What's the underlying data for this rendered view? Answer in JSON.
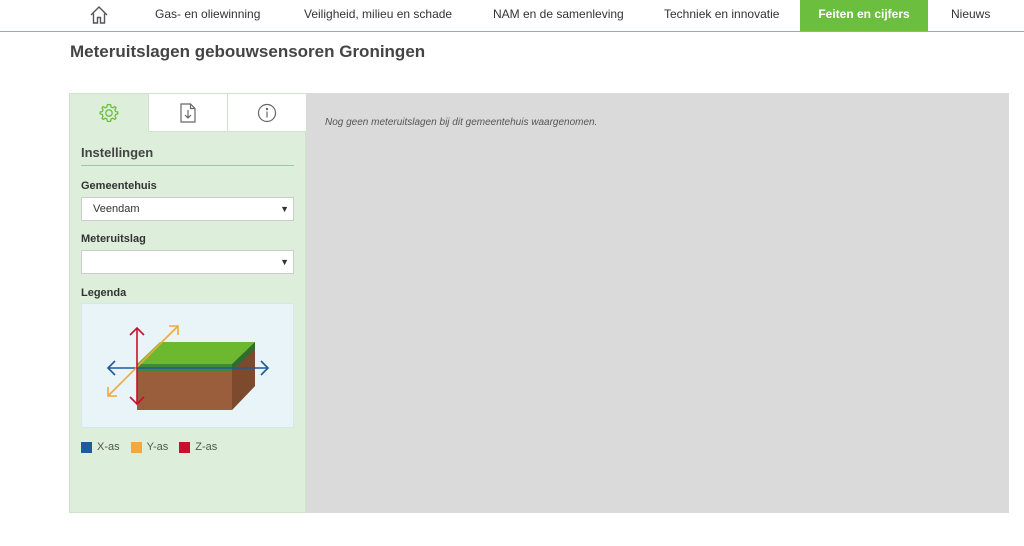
{
  "nav": {
    "items": [
      {
        "label": "Gas- en oliewinning"
      },
      {
        "label": "Veiligheid, milieu en schade"
      },
      {
        "label": "NAM en de samenleving"
      },
      {
        "label": "Techniek en innovatie"
      },
      {
        "label": "Feiten en cijfers",
        "active": true
      },
      {
        "label": "Nieuws"
      }
    ],
    "home_icon": "home-icon"
  },
  "page": {
    "title": "Meteruitslagen gebouwsensoren Groningen"
  },
  "panel": {
    "tabs": [
      {
        "icon": "gear-icon",
        "active": true
      },
      {
        "icon": "download-document-icon"
      },
      {
        "icon": "info-icon"
      }
    ],
    "title": "Instellingen",
    "gemeentehuis": {
      "label": "Gemeentehuis",
      "value": "Veendam"
    },
    "meteruitslag": {
      "label": "Meteruitslag",
      "value": ""
    },
    "legend": {
      "label": "Legenda",
      "items": [
        {
          "label": "X-as",
          "color": "#1f5a9a"
        },
        {
          "label": "Y-as",
          "color": "#f2a83a"
        },
        {
          "label": "Z-as",
          "color": "#c8102e"
        }
      ]
    }
  },
  "content": {
    "message": "Nog geen meteruitslagen bij dit gemeentehuis waargenomen."
  },
  "colors": {
    "accent": "#6cbf3e",
    "panel_bg": "#ddeedb",
    "content_bg": "#dadada"
  }
}
